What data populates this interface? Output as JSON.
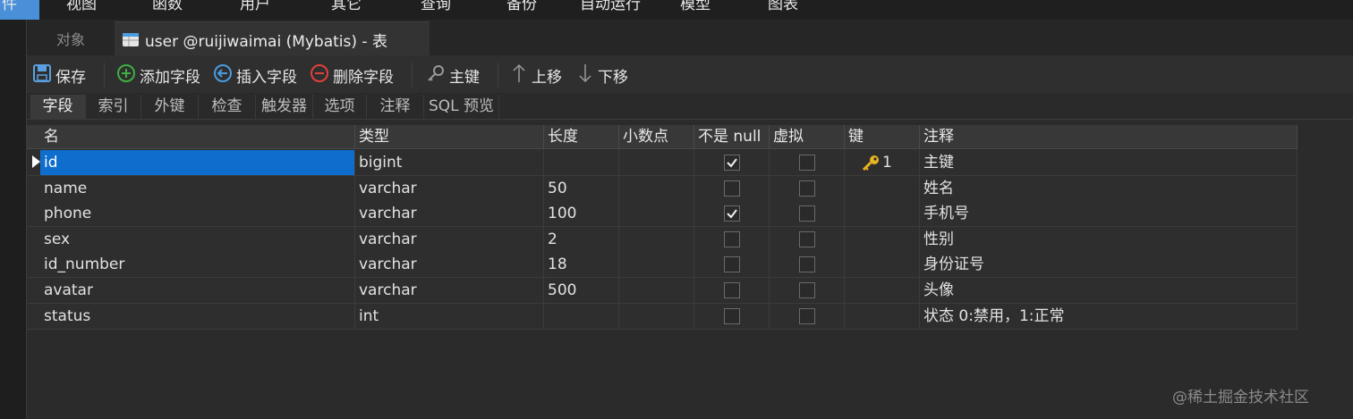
{
  "menu": {
    "first": "件",
    "items": [
      "视图",
      "函数",
      "用户",
      "其它",
      "查询",
      "备份",
      "自动运行",
      "模型",
      "图表"
    ]
  },
  "tabs": {
    "objects": "对象",
    "active_title": "user @ruijiwaimai (Mybatis) - 表"
  },
  "toolbar": {
    "save": "保存",
    "add_field": "添加字段",
    "insert_field": "插入字段",
    "delete_field": "删除字段",
    "primary_key": "主键",
    "move_up": "上移",
    "move_down": "下移"
  },
  "subtabs": [
    "字段",
    "索引",
    "外键",
    "检查",
    "触发器",
    "选项",
    "注释",
    "SQL 预览"
  ],
  "grid": {
    "columns": [
      "名",
      "类型",
      "长度",
      "小数点",
      "不是 null",
      "虚拟",
      "键",
      "注释"
    ],
    "rows": [
      {
        "name": "id",
        "type": "bigint",
        "length": "",
        "decimals": "",
        "not_null": true,
        "virtual": false,
        "key": "1",
        "comment": "主键"
      },
      {
        "name": "name",
        "type": "varchar",
        "length": "50",
        "decimals": "",
        "not_null": false,
        "virtual": false,
        "key": "",
        "comment": "姓名"
      },
      {
        "name": "phone",
        "type": "varchar",
        "length": "100",
        "decimals": "",
        "not_null": true,
        "virtual": false,
        "key": "",
        "comment": "手机号"
      },
      {
        "name": "sex",
        "type": "varchar",
        "length": "2",
        "decimals": "",
        "not_null": false,
        "virtual": false,
        "key": "",
        "comment": "性别"
      },
      {
        "name": "id_number",
        "type": "varchar",
        "length": "18",
        "decimals": "",
        "not_null": false,
        "virtual": false,
        "key": "",
        "comment": "身份证号"
      },
      {
        "name": "avatar",
        "type": "varchar",
        "length": "500",
        "decimals": "",
        "not_null": false,
        "virtual": false,
        "key": "",
        "comment": "头像"
      },
      {
        "name": "status",
        "type": "int",
        "length": "",
        "decimals": "",
        "not_null": false,
        "virtual": false,
        "key": "",
        "comment": "状态 0:禁用，1:正常"
      }
    ]
  },
  "watermark": "@稀土掘金技术社区",
  "colors": {
    "selection": "#0f6ecd",
    "key_icon": "#e8b520",
    "menu_accent": "#4a90d9"
  }
}
